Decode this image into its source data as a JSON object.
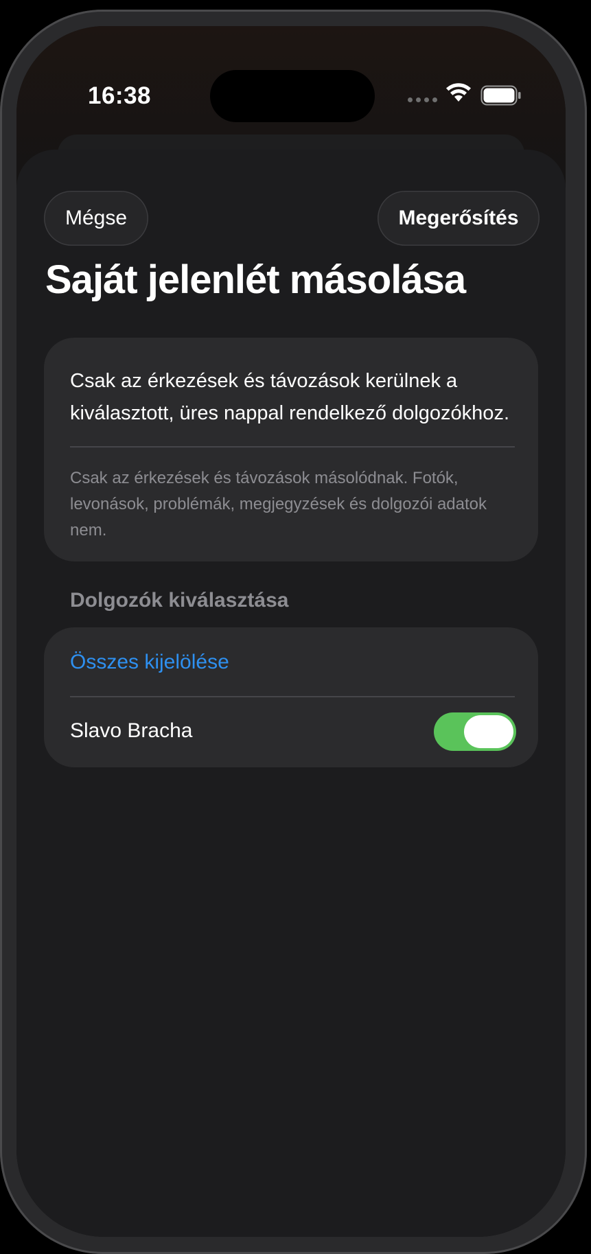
{
  "status_bar": {
    "time": "16:38"
  },
  "header": {
    "cancel_label": "Mégse",
    "confirm_label": "Megerősítés",
    "title": "Saját jelenlét másolása"
  },
  "info": {
    "main_text": "Csak az érkezések és távozások kerülnek a kiválasztott, üres nappal rendelkező dolgozókhoz.",
    "sub_text": "Csak az érkezések és távozások másolódnak. Fotók, levonások, problémák, megjegyzések és dolgozói adatok nem."
  },
  "employees": {
    "section_title": "Dolgozók kiválasztása",
    "select_all_label": "Összes kijelölése",
    "items": [
      {
        "name": "Slavo Bracha",
        "selected": true
      }
    ]
  },
  "colors": {
    "accent": "#2e90f0",
    "toggle_on": "#5ac35a"
  }
}
